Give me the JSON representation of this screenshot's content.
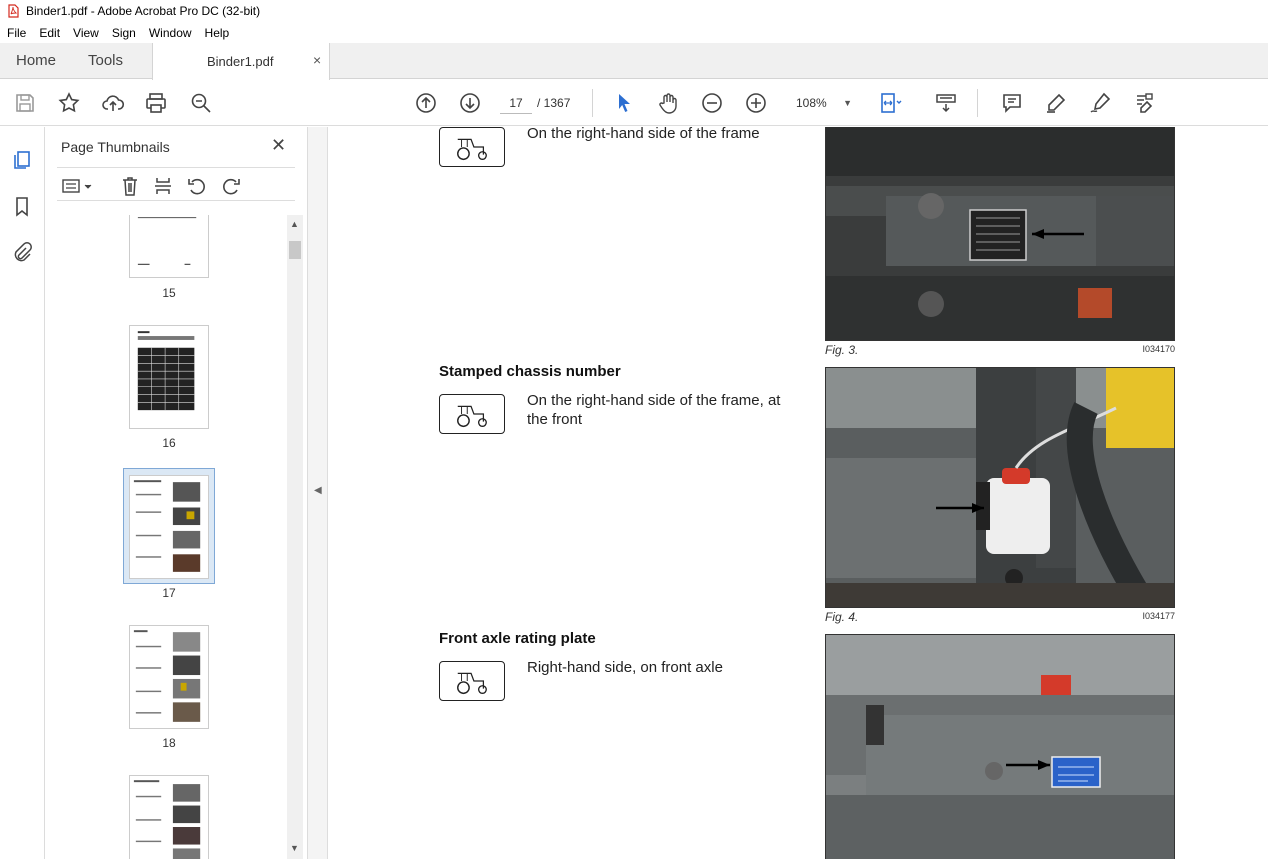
{
  "window": {
    "title": "Binder1.pdf - Adobe Acrobat Pro DC (32-bit)"
  },
  "menu": [
    "File",
    "Edit",
    "View",
    "Sign",
    "Window",
    "Help"
  ],
  "tabs": {
    "home": "Home",
    "tools": "Tools",
    "document": "Binder1.pdf",
    "close": "×"
  },
  "toolbar": {
    "current_page": "17",
    "total_pages": "/ 1367",
    "zoom": "108%"
  },
  "panel": {
    "title": "Page Thumbnails",
    "close": "✕",
    "thumbnails": [
      {
        "label": "15"
      },
      {
        "label": "16"
      },
      {
        "label": "17"
      },
      {
        "label": "18"
      }
    ],
    "selected_page": "17"
  },
  "document": {
    "sections": [
      {
        "text": "On the right-hand side of the frame",
        "caption": "Fig. 3.",
        "fig_id": "I034170"
      },
      {
        "heading": "Stamped chassis number",
        "text": "On the right-hand side of the frame, at the front",
        "caption": "Fig. 4.",
        "fig_id": "I034177"
      },
      {
        "heading": "Front axle rating plate",
        "text": "Right-hand side, on front axle"
      }
    ]
  },
  "colors": {
    "acrobat_red": "#d42a1f",
    "accent_blue": "#2d6fd1",
    "selection": "#dbe8f5"
  }
}
